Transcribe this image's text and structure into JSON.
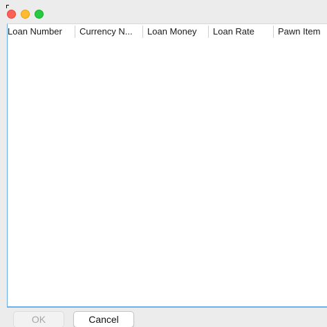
{
  "window": {
    "controls": {
      "close_color": "#fe5f57",
      "minimize_color": "#febc2e",
      "zoom_color": "#28c840"
    }
  },
  "table": {
    "columns": [
      "Loan Number",
      "Currency N...",
      "Loan Money",
      "Loan Rate",
      "Pawn Item"
    ],
    "rows": []
  },
  "buttons": {
    "ok_label": "OK",
    "cancel_label": "Cancel"
  },
  "colors": {
    "selection_accent": "#66a9e6"
  }
}
